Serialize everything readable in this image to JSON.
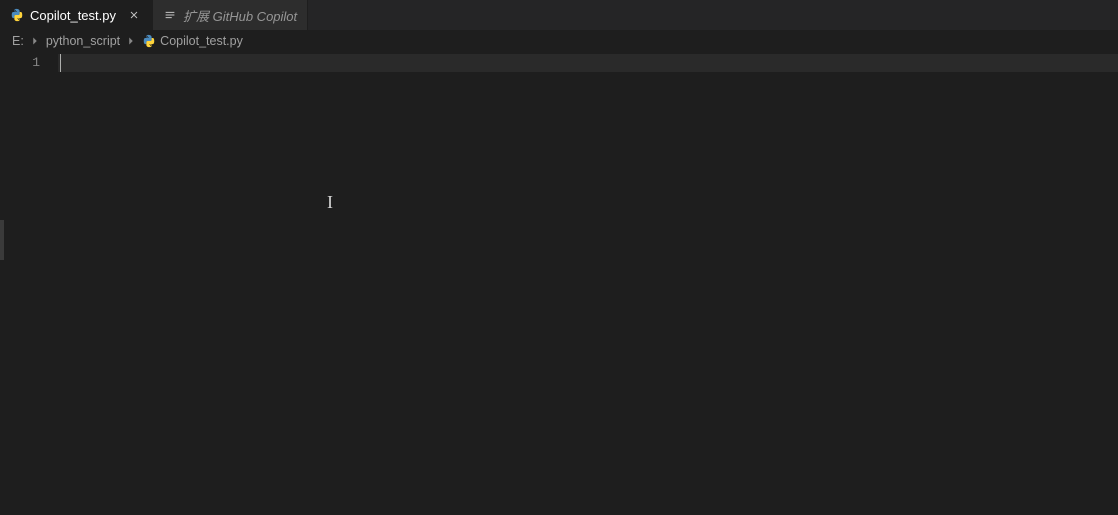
{
  "tabs": [
    {
      "label": "Copilot_test.py",
      "icon": "python-icon",
      "active": true,
      "closable": true
    },
    {
      "label": "扩展 GitHub Copilot",
      "icon": "extension-icon",
      "active": false,
      "closable": false
    }
  ],
  "breadcrumb": {
    "root": "E:",
    "folder": "python_script",
    "file": "Copilot_test.py"
  },
  "editor": {
    "line_numbers": [
      "1"
    ],
    "content": ""
  }
}
